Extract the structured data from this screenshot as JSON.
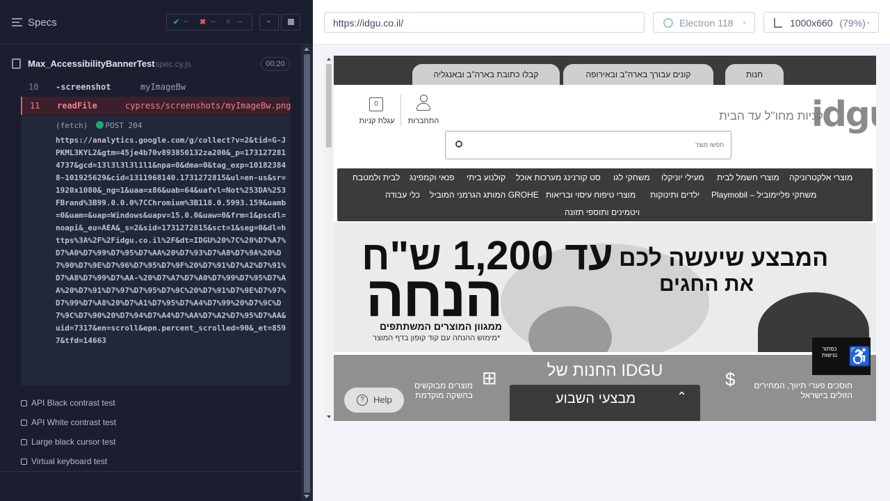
{
  "reporter": {
    "specs_title": "Specs",
    "stats": {
      "passed": "--",
      "failed": "--",
      "pending": "--"
    },
    "spec": {
      "name": "Max_AccessibilityBannerTest",
      "file": "spec.cy.js",
      "duration": "00:20"
    },
    "commands": [
      {
        "num": "10",
        "name": "-screenshot",
        "arg": "myImageBw"
      },
      {
        "num": "11",
        "name": "readFile",
        "arg": "cypress/screenshots/myImageBw.png"
      }
    ],
    "fetch": {
      "label": "(fetch)",
      "method": "POST 204"
    },
    "request_url": "https://analytics.google.com/g/collect?v=2&tid=G-JPKML3KYL2&gtm=45je4b70v893850132za200&_p=1731272814737&gcd=13l3l3l3l1l1&npa=0&dma=0&tag_exp=101823848~101925629&cid=1311968140.1731272815&ul=en-us&sr=1920x1080&_ng=1&uaa=x86&uab=64&uafvl=Not%253DA%253FBrand%3B99.0.0.0%7CChromium%3B118.0.5993.159&uamb=0&uam=&uap=Windows&uapv=15.0.0&uaw=0&frm=1&pscdl=noapi&_eu=AEA&_s=2&sid=1731272815&sct=1&seg=0&dl=https%3A%2F%2Fidgu.co.il%2F&dt=IDGU%20%7C%20%D7%A7%D7%A0%D7%99%D7%95%D7%AA%20%D7%93%D7%A8%D7%9A%20%D7%90%D7%9E%D7%96%D7%95%D7%9F%20%D7%91%D7%A2%D7%91%D7%A8%D7%99%D7%AA-%20%D7%A7%D7%A0%D7%99%D7%95%D7%AA%20%D7%91%D7%97%D7%95%D7%9C%20%D7%91%D7%9E%D7%97%D7%99%D7%A8%20%D7%A1%D7%95%D7%A4%D7%99%20%D7%9C%D7%9C%D7%90%20%D7%94%D7%A4%D7%AA%D7%A2%D7%95%D7%AA&uid=7317&en=scroll&epn.percent_scrolled=90&_et=8597&tfd=14663",
    "tests": [
      "API Black contrast test",
      "API White contrast test",
      "Large black cursor test",
      "Virtual keyboard test"
    ]
  },
  "browser": {
    "url": "https://idgu.co.il/",
    "browser_name": "Electron 118",
    "viewport": "1000x660",
    "zoom": "(79%)"
  },
  "site": {
    "top_tabs": [
      "חנות",
      "קונים עבורך בארה\"ב ובאירופה",
      "קבלו כתובת בארה\"ב ובאנגליה"
    ],
    "logo": "idgu",
    "tagline": "קניות מחו\"ל עד הבית",
    "login_label": "התחברות",
    "cart_label": "עגלת קניות",
    "cart_count": "0",
    "search_placeholder": "חפשו מוצר",
    "menu_row1": [
      "מוצרי אלקטרוניקה",
      "מוצרי חשמל לבית",
      "מעילי יוניקלו",
      "משחקי לגו",
      "סט קורנינג מערכות אוכל",
      "קולנוע ביתי",
      "פנאי וקמפינג",
      "לבית ולמטבח"
    ],
    "menu_row2": [
      "משחקי פליימוביל – Playmobil",
      "ילדים ותינוקות",
      "מוצרי טיפוח עיסוי ובריאות",
      "GROHE המותג הגרמני המוביל",
      "כלי עבודה"
    ],
    "menu_row3": [
      "ויטמינים ותוספי תזונה"
    ],
    "promo": {
      "amount": "עד 1,200 ש\"ח",
      "discount": "הנחה",
      "sub": "ממגוון המוצרים המשתתפים",
      "note": "*מימוש ההנחה עם קוד קופון בדף המוצר",
      "headline1": "המבצע שיעשה לכם",
      "headline2": "את החגים"
    },
    "accessibility_label": "כפתור נגישות",
    "stores_title": "החנות של IDGU",
    "feature_left": "מוצרים מבוקשים בהשקה מוקדמת",
    "feature_right": "חוסכים פערי תיווך, המחירים הזולים בישראל",
    "deals_title": "מבצעי השבוע",
    "help_label": "Help"
  }
}
